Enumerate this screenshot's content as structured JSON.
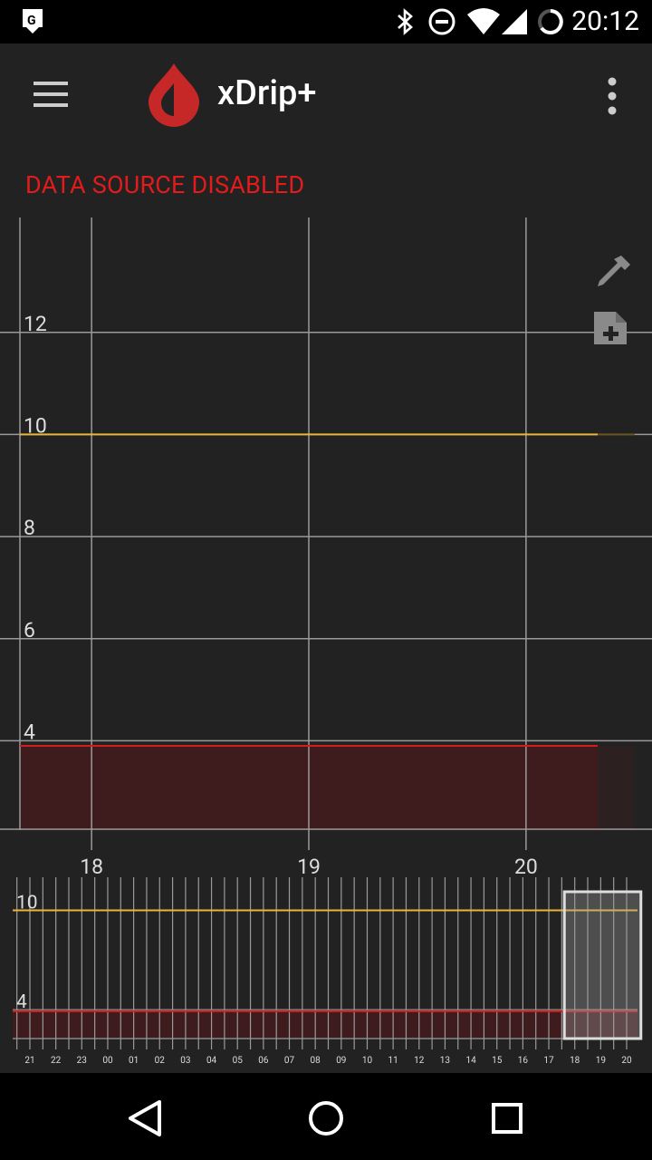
{
  "status_bar": {
    "time": "20:12",
    "icons": [
      "maps-notification-icon",
      "bluetooth-icon",
      "do-not-disturb-icon",
      "wifi-icon",
      "signal-icon",
      "battery-icon"
    ]
  },
  "toolbar": {
    "title": "xDrip+",
    "menu_icon": "hamburger-menu-icon",
    "logo_icon": "blood-drop-logo",
    "overflow_icon": "more-vert-icon"
  },
  "status_message": "DATA SOURCE DISABLED",
  "colors": {
    "background": "#222222",
    "grid": "#9a9a9a",
    "high_line": "#e8b73a",
    "low_line": "#d11f1f",
    "low_fill": "#3e1c1e",
    "warning_text": "#e31b1b",
    "viewport": "#dddddd"
  },
  "fabs": {
    "eyedropper_icon": "eyedropper-icon",
    "add_note_icon": "add-note-icon"
  },
  "chart_data": [
    {
      "type": "line",
      "x_axis": {
        "tick_labels": [
          "18",
          "19",
          "20"
        ],
        "range": [
          17.67,
          20.58
        ]
      },
      "y_axis": {
        "tick_labels": [
          "4",
          "6",
          "8",
          "10",
          "12"
        ],
        "range": [
          2.25,
          14.25
        ]
      },
      "high_threshold": 10,
      "low_threshold": 3.9,
      "grid": true,
      "series": []
    },
    {
      "type": "line",
      "x_axis": {
        "tick_labels": [
          "21",
          "22",
          "23",
          "00",
          "01",
          "02",
          "03",
          "04",
          "05",
          "06",
          "07",
          "08",
          "09",
          "10",
          "11",
          "12",
          "13",
          "14",
          "15",
          "16",
          "17",
          "18",
          "19",
          "20"
        ]
      },
      "y_axis": {
        "tick_labels": [
          "4",
          "10"
        ]
      },
      "high_threshold": 10,
      "low_threshold": 3.9,
      "viewport_hours": [
        "18",
        "20"
      ],
      "grid": true,
      "series": []
    }
  ],
  "navigation": {
    "back_icon": "back-triangle-icon",
    "home_icon": "home-circle-icon",
    "recents_icon": "recents-square-icon"
  }
}
